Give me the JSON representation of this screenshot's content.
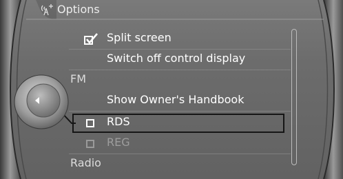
{
  "header": {
    "title": "Options",
    "icon": "antenna-signal-icon"
  },
  "menu": {
    "split_screen": {
      "label": "Split screen",
      "checked": true
    },
    "switch_off_display": {
      "label": "Switch off control display"
    },
    "section_fm": {
      "label": "FM"
    },
    "owners_handbook": {
      "label": "Show Owner's Handbook"
    },
    "rds": {
      "label": "RDS",
      "checked": false
    },
    "reg": {
      "label": "REG",
      "checked": false
    },
    "section_radio": {
      "label": "Radio"
    }
  },
  "colors": {
    "background": "#6f6f6f",
    "text": "#ffffff",
    "disabled_text": "#9d9d9d",
    "highlight_border": "#151515"
  }
}
